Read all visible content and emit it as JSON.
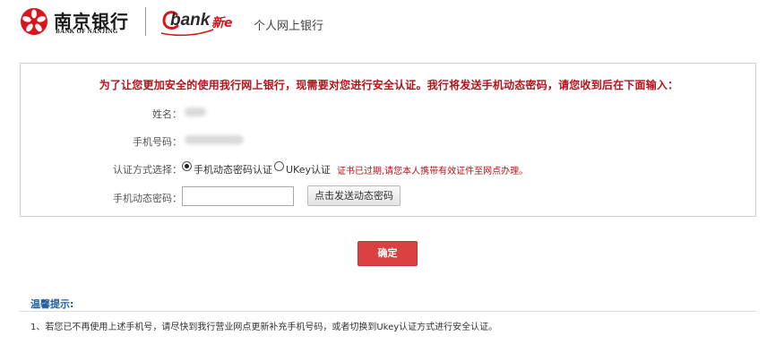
{
  "header": {
    "bank_name_cn": "南京银行",
    "bank_name_en": "BANK OF NANJING",
    "ebank_brand": "bank",
    "ebank_suffix": "新e",
    "page_title": "个人网上银行"
  },
  "form": {
    "notice": "为了让您更加安全的使用我行网上银行，现需要对您进行安全认证。我行将发送手机动态密码，请您收到后在下面输入：",
    "name_label": "姓名：",
    "phone_label": "手机号码：",
    "auth_method_label": "认证方式选择：",
    "auth_options": [
      {
        "label": "手机动态密码认证",
        "selected": true
      },
      {
        "label": "UKey认证",
        "selected": false
      }
    ],
    "cert_warning": "证书已过期,请您本人携带有效证件至网点办理。",
    "otp_label": "手机动态密码：",
    "otp_value": "",
    "send_otp_button": "点击发送动态密码"
  },
  "confirm_button": "确定",
  "tips": {
    "title": "温馨提示:",
    "items": [
      "1、若您已不再使用上述手机号，请尽快到我行营业网点更新补充手机号码，或者切换到Ukey认证方式进行安全认证。"
    ]
  },
  "colors": {
    "brand_red": "#d8161d",
    "notice_red": "#b3141b",
    "confirm_button_bg": "#d9403f",
    "tips_blue": "#1d5fa0"
  },
  "icons": {
    "bank_logo": "bank-of-nanjing-emblem-icon",
    "ebank_logo": "ebank-e-icon"
  }
}
